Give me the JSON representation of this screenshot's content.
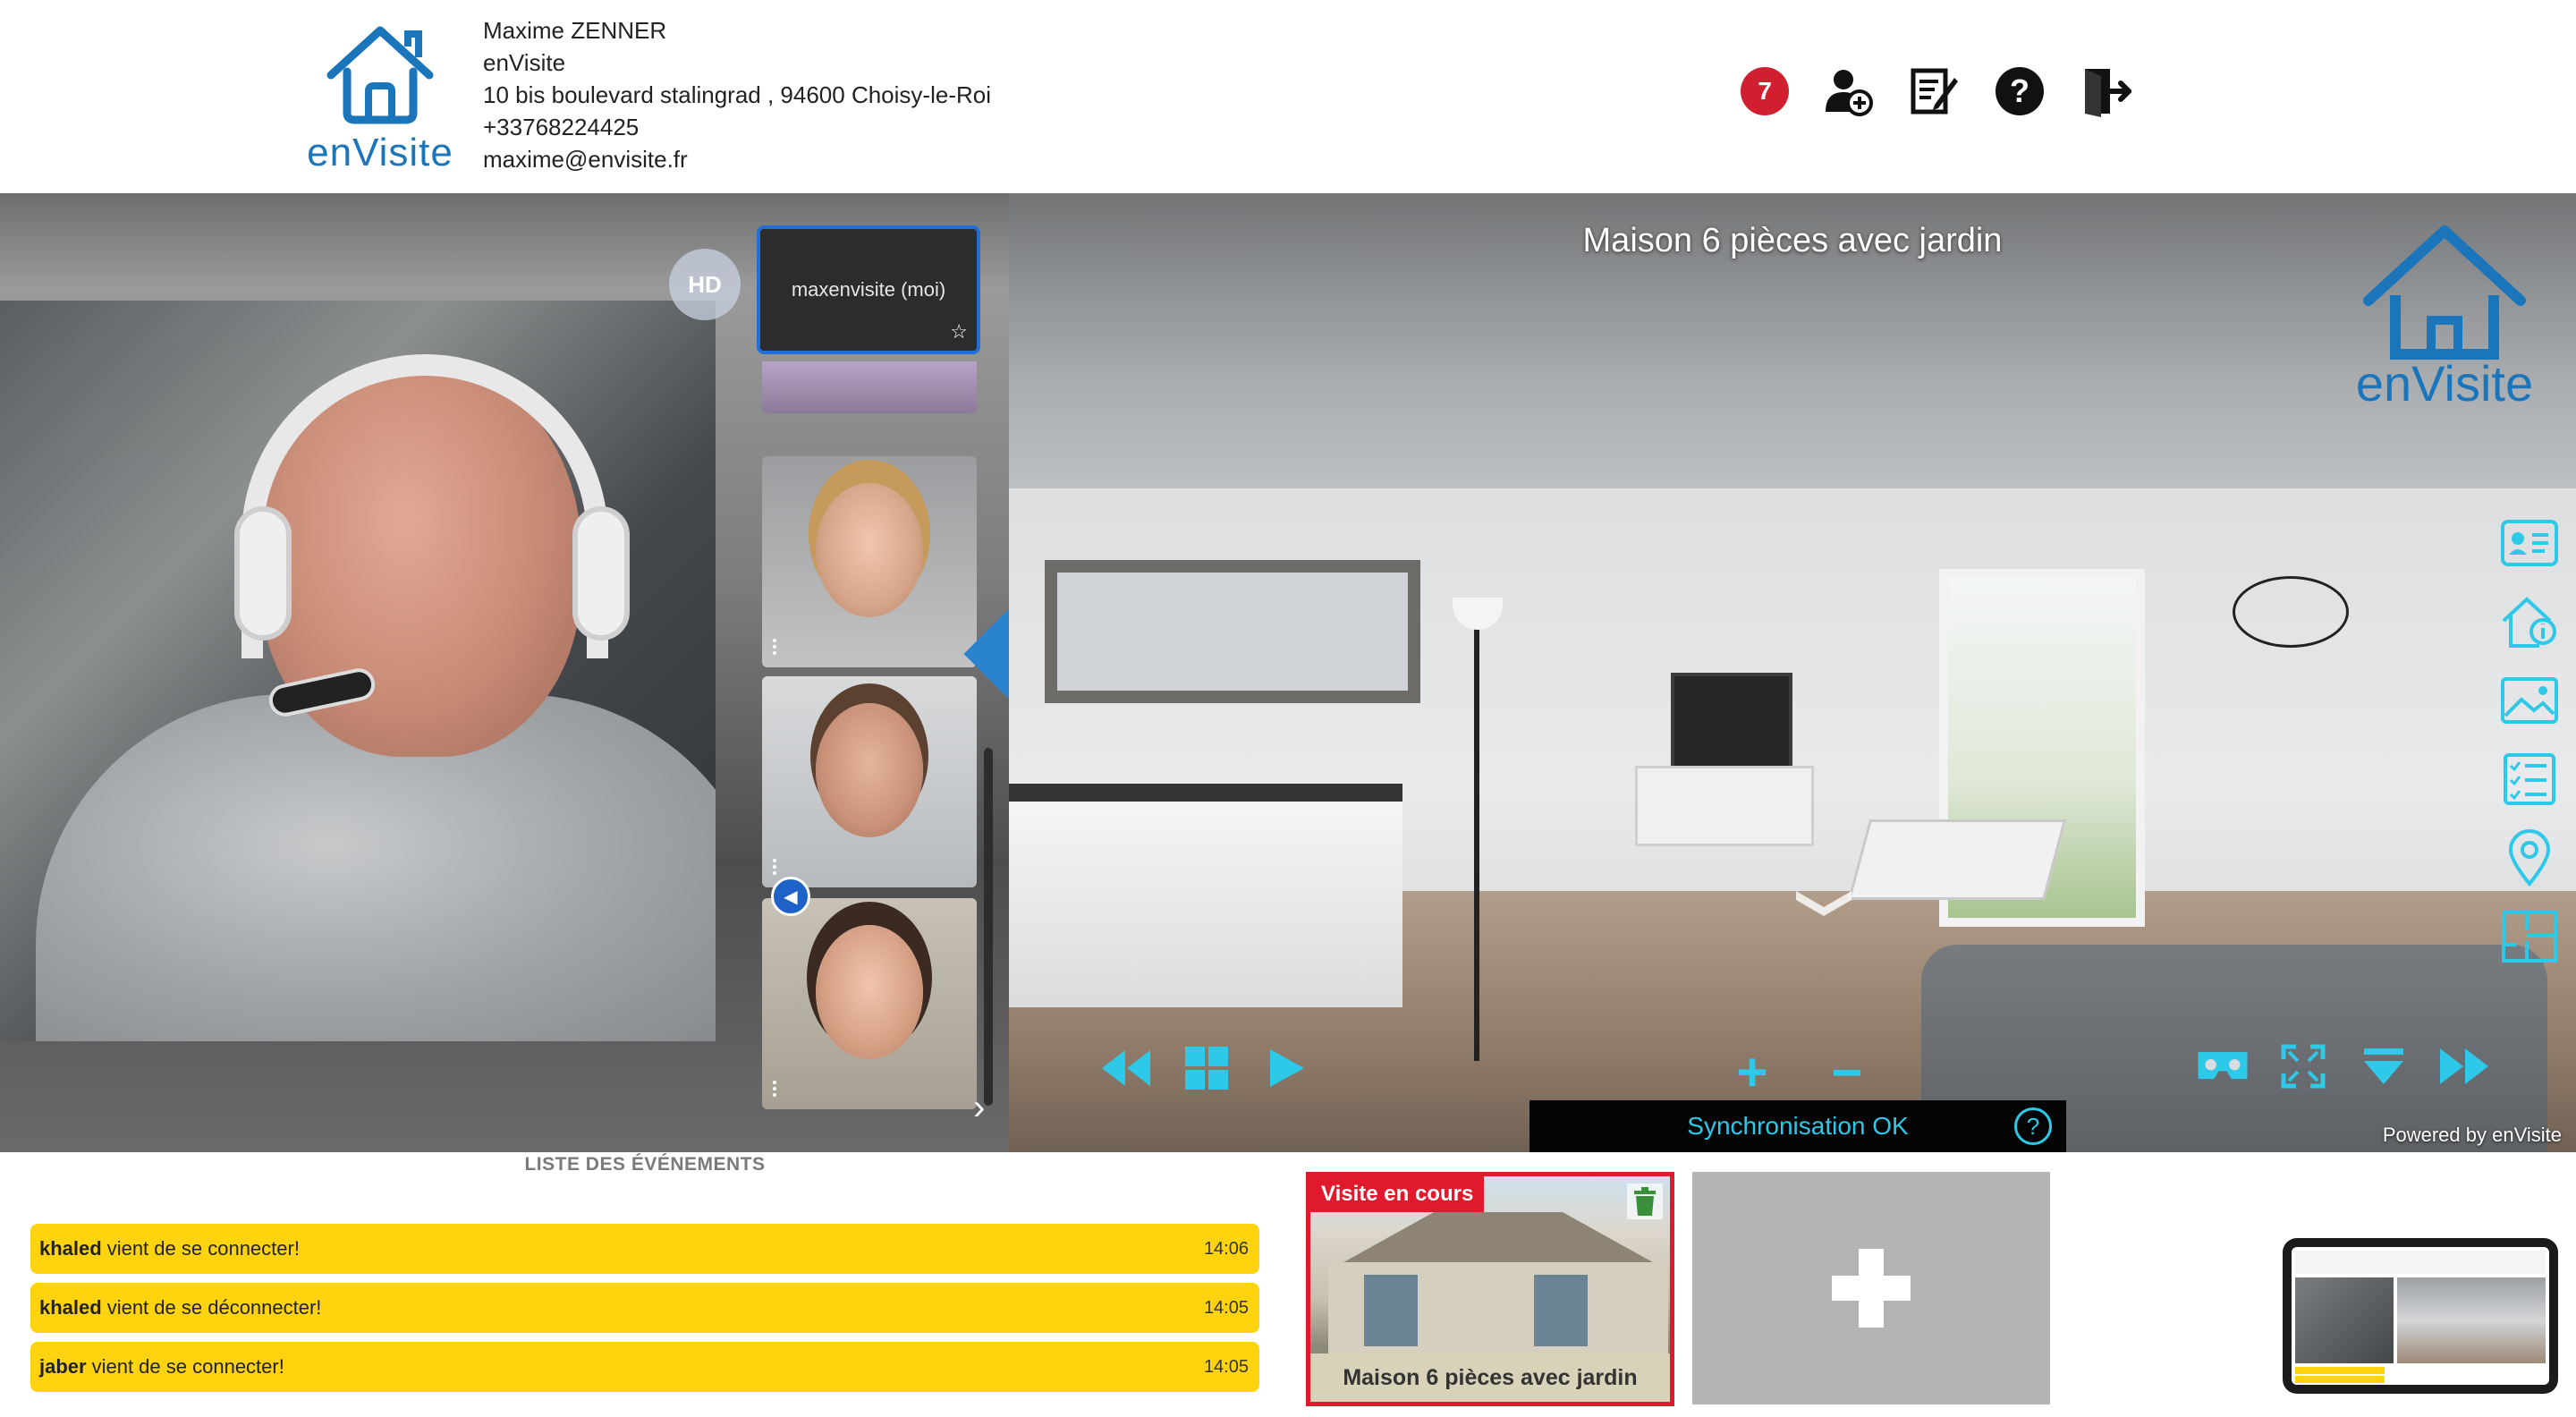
{
  "header": {
    "logo_text": "enVisite",
    "contact": {
      "name": "Maxime ZENNER",
      "company": "enVisite",
      "address": "10 bis boulevard stalingrad , 94600 Choisy-le-Roi",
      "phone": "+33768224425",
      "email": "maxime@envisite.fr"
    },
    "notification_count": "7",
    "toolbar_icons": [
      "add-user-icon",
      "report-icon",
      "help-icon",
      "logout-icon"
    ]
  },
  "video": {
    "hd_label": "HD",
    "self_label": "maxenvisite (moi)",
    "self_star": "☆",
    "participants": [
      "participant-woman",
      "participant-man",
      "participant-girl"
    ]
  },
  "viewer": {
    "title": "Maison 6 pièces avec jardin",
    "logo_text": "enVisite",
    "side_icons": [
      "contact-card-icon",
      "house-info-icon",
      "gallery-icon",
      "checklist-icon",
      "location-pin-icon",
      "floorplan-icon"
    ],
    "zoom_in": "+",
    "zoom_out": "−",
    "sync_text": "Synchronisation OK",
    "sync_help": "?",
    "powered_by": "Powered by enVisite"
  },
  "events": {
    "title": "LISTE DES ÉVÉNEMENTS",
    "items": [
      {
        "user": "khaled",
        "text": "vient de se connecter!",
        "time": "14:06"
      },
      {
        "user": "khaled",
        "text": "vient de se déconnecter!",
        "time": "14:05"
      },
      {
        "user": "jaber",
        "text": "vient de se connecter!",
        "time": "14:05"
      }
    ]
  },
  "visits": {
    "current_tag": "Visite en cours",
    "current_title": "Maison 6 pièces avec jardin"
  },
  "colors": {
    "brand_blue": "#1b75bb",
    "accent_cyan": "#2ec8e8",
    "event_yellow": "#ffd40f",
    "alert_red": "#e0192c"
  }
}
